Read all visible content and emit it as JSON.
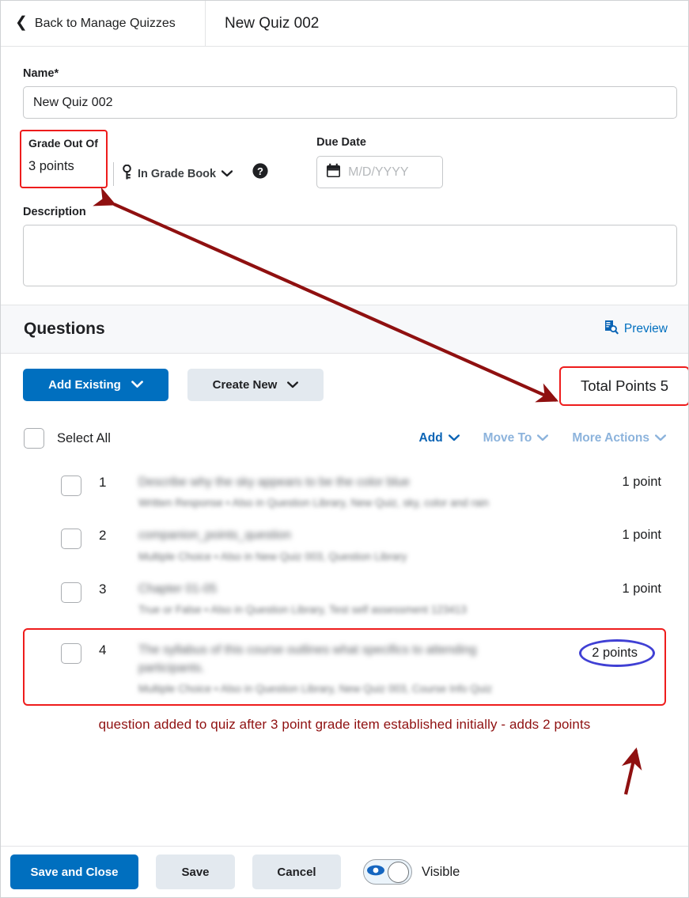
{
  "topbar": {
    "back_label": "Back to Manage Quizzes",
    "back_icon": "chevron-left-icon",
    "quiz_title": "New Quiz 002"
  },
  "form": {
    "name_label": "Name",
    "name_required_marker": "*",
    "name_value": "New Quiz 002",
    "grade_out_of_label": "Grade Out Of",
    "grade_out_of_value": "3 points",
    "gradebook_icon": "key-icon",
    "gradebook_label": "In Grade Book",
    "gradebook_caret": "chevron-down-icon",
    "help_icon": "help-circle-icon",
    "due_date_label": "Due Date",
    "due_date_icon": "calendar-icon",
    "due_date_placeholder": "M/D/YYYY",
    "due_date_value": "",
    "description_label": "Description",
    "description_value": ""
  },
  "questions_section": {
    "heading": "Questions",
    "preview_icon": "document-search-icon",
    "preview_label": "Preview",
    "add_existing_label": "Add Existing",
    "create_new_label": "Create New",
    "dropdown_caret": "chevron-down-icon",
    "total_points_label": "Total Points 5",
    "select_all_label": "Select All",
    "actions": [
      {
        "label": "Add",
        "state": "enabled"
      },
      {
        "label": "Move To",
        "state": "disabled"
      },
      {
        "label": "More Actions",
        "state": "disabled"
      }
    ],
    "rows": [
      {
        "number": "1",
        "title": "Describe why the sky appears to be the color blue",
        "meta": "Written Response  •  Also in Question Library, New Quiz, sky, color and rain",
        "points": "1 point"
      },
      {
        "number": "2",
        "title": "companion_points_question",
        "meta": "Multiple Choice  •  Also in New Quiz 003, Question Library",
        "points": "1 point"
      },
      {
        "number": "3",
        "title": "Chapter 01-05",
        "meta": "True or False  •  Also in Question Library, Test self assessment 123413",
        "points": "1 point"
      },
      {
        "number": "4",
        "title": "The syllabus of this course outlines what specifics to attending participants.",
        "meta": "Multiple Choice  •  Also in Question Library, New Quiz 003, Course Info Quiz",
        "points": "2 points"
      }
    ]
  },
  "annotation": {
    "caption": "question added to quiz after 3 point grade item established initially - adds 2 points",
    "caption_color": "#8f1010",
    "highlight_color": "#ee1c1c",
    "ellipse_color": "#4040d4",
    "arrow_color": "#8f1010"
  },
  "footer": {
    "save_and_close_label": "Save and Close",
    "save_label": "Save",
    "cancel_label": "Cancel",
    "visibility_icon": "eye-icon",
    "visibility_label": "Visible"
  },
  "colors": {
    "primary_blue": "#006fbf",
    "secondary_gray": "#e3e9ef",
    "link_blue": "#0b64b5",
    "disabled_link_blue": "#8cb3dc"
  }
}
